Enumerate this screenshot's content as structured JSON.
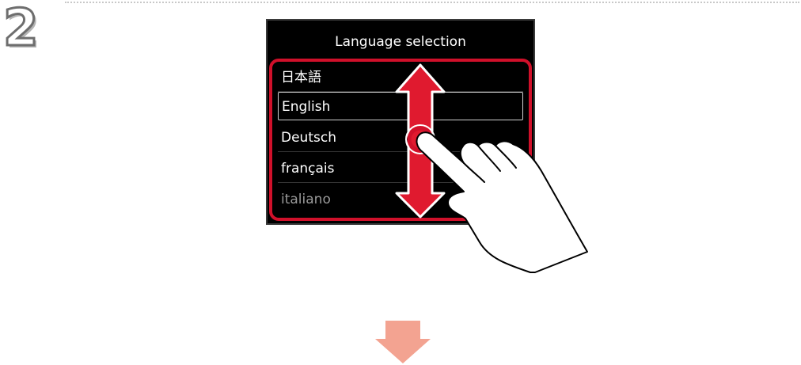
{
  "step": {
    "number": "2"
  },
  "screen": {
    "title": "Language selection",
    "languages": [
      {
        "label": "日本語",
        "state": "normal"
      },
      {
        "label": "English",
        "state": "selected"
      },
      {
        "label": "Deutsch",
        "state": "normal"
      },
      {
        "label": "français",
        "state": "normal"
      },
      {
        "label": "italiano",
        "state": "faded"
      }
    ],
    "selected_language": "English"
  },
  "gesture": {
    "type": "vertical-swipe",
    "icon": "hand-swipe-icon"
  },
  "colors": {
    "highlight": "#d0102a",
    "arrow_fill": "#e01a2f",
    "next_arrow": "#f3a391",
    "screen_bg": "#000000",
    "text": "#ffffff"
  }
}
